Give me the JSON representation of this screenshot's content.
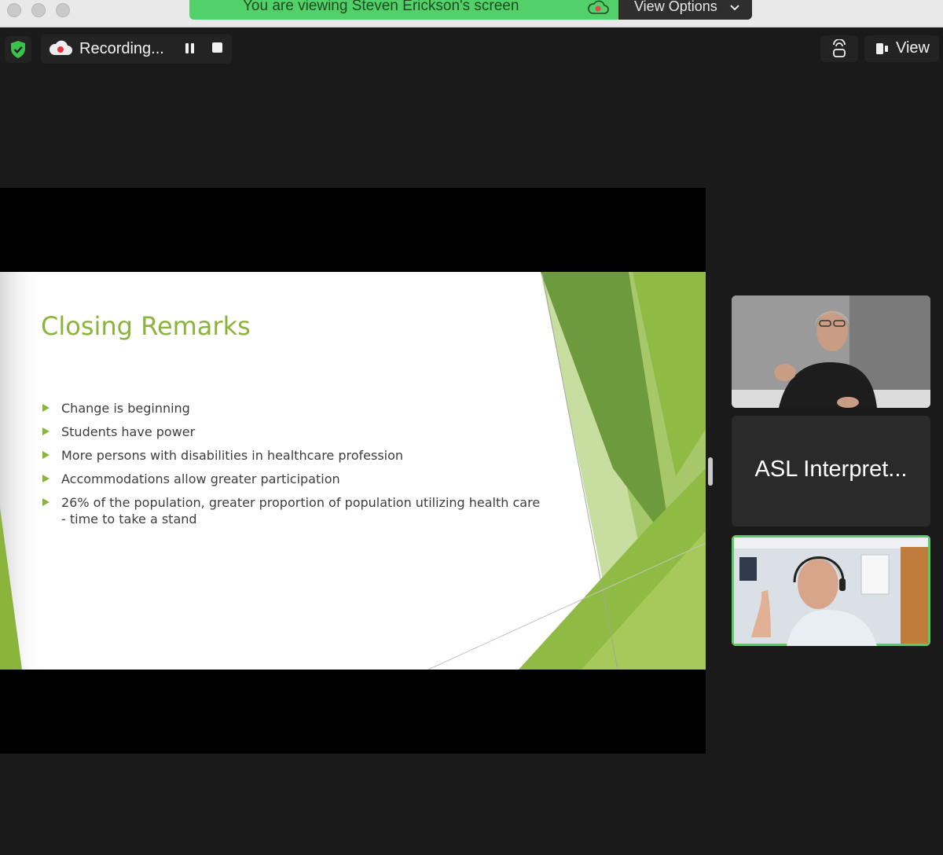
{
  "window": {
    "share_banner_text": "You are viewing Steven Erickson's screen",
    "view_options_label": "View Options"
  },
  "toolbar": {
    "recording_label": "Recording...",
    "view_label": "View"
  },
  "slide": {
    "title": "Closing Remarks",
    "bullets": [
      "Change is beginning",
      "Students have power",
      "More persons with disabilities in healthcare profession",
      "Accommodations allow greater participation",
      "26% of the population, greater proportion of population utilizing health care - time to take a stand"
    ],
    "accent_color": "#8ab43c"
  },
  "participants": [
    {
      "name": "",
      "type": "video"
    },
    {
      "name": "ASL Interpret...",
      "type": "name-only"
    },
    {
      "name": "",
      "type": "video",
      "active_speaker": true
    }
  ],
  "colors": {
    "banner_green": "#52d16a",
    "active_speaker_border": "#55d163"
  }
}
